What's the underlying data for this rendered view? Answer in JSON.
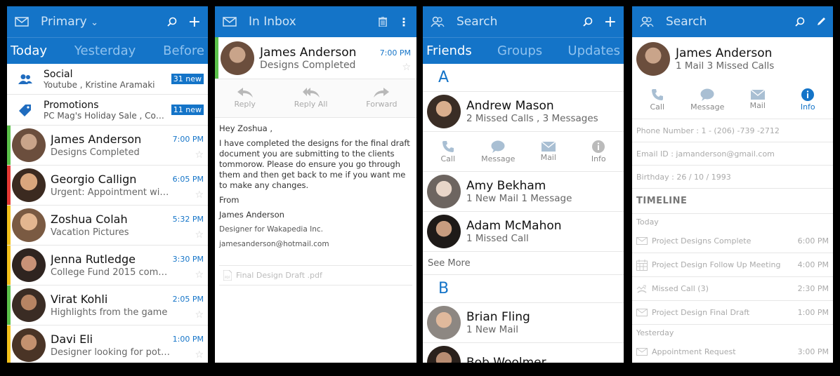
{
  "colors": {
    "accent": "#1474c8",
    "green": "#5cc24b",
    "red": "#e53935",
    "yellow": "#f4c21c"
  },
  "screen1": {
    "title": "Primary",
    "tabs": [
      "Today",
      "Yesterday",
      "Before"
    ],
    "categories": [
      {
        "name": "Social",
        "sub": "Youtube , Kristine Aramaki",
        "badge": "31 new",
        "icon": "people-icon"
      },
      {
        "name": "Promotions",
        "sub": "PC Mag's Holiday Sale , Cour...",
        "badge": "11 new",
        "icon": "tag-icon"
      }
    ],
    "mails": [
      {
        "name": "James Anderson",
        "sub": "Designs Completed",
        "time": "7:00 PM",
        "stripe": "#5cc24b"
      },
      {
        "name": "Georgio Callign",
        "sub": "Urgent: Appointment with ...",
        "time": "6:05 PM",
        "stripe": "#e53935"
      },
      {
        "name": "Zoshua Colah",
        "sub": "Vacation Pictures",
        "time": "5:32 PM",
        "stripe": "#f4c21c"
      },
      {
        "name": "Jenna Rutledge",
        "sub": "College Fund 2015 complete",
        "time": "3:30 PM",
        "stripe": "#f4c21c"
      },
      {
        "name": "Virat Kohli",
        "sub": "Highlights from the game",
        "time": "2:05 PM",
        "stripe": "#5cc24b"
      },
      {
        "name": "Davi Eli",
        "sub": "Designer looking for poten...",
        "time": "1:00 PM",
        "stripe": "#f4c21c"
      }
    ]
  },
  "screen2": {
    "title": "In Inbox",
    "sender": "James Anderson",
    "subject": "Designs Completed",
    "time": "7:00 PM",
    "actions": [
      "Reply",
      "Reply All",
      "Forward"
    ],
    "greeting": "Hey Zoshua ,",
    "body": "I have completed the designs for the final draft document you are submitting to the clients tommorow. Please do ensure you go through them and then get back to me if you want me to make any changes.",
    "from_label": "From",
    "signature_name": "James Anderson",
    "signature_title": "Designer for Wakapedia Inc.",
    "signature_email": "jamesanderson@hotmail.com",
    "attachment": "Final Design Draft .pdf"
  },
  "screen3": {
    "title": "Search",
    "tabs": [
      "Friends",
      "Groups",
      "Updates"
    ],
    "letter_a": "A",
    "letter_b": "B",
    "contact_first": {
      "name": "Andrew Mason",
      "sub": "2 Missed Calls ,  3 Messages"
    },
    "quick_actions": [
      "Call",
      "Message",
      "Mail",
      "Info"
    ],
    "contacts_a": [
      {
        "name": "Amy Bekham",
        "sub": "1 New Mail 1 Message"
      },
      {
        "name": "Adam McMahon",
        "sub": "1 Missed Call"
      }
    ],
    "see_more": "See More",
    "contacts_b": [
      {
        "name": "Brian Fling",
        "sub": "1 New Mail"
      },
      {
        "name": "Bob Woolmer",
        "sub": ""
      }
    ]
  },
  "screen4": {
    "title": "Search",
    "name": "James Anderson",
    "sub": "1 Mail 3 Missed Calls",
    "quick_actions": [
      "Call",
      "Message",
      "Mail",
      "Info"
    ],
    "phone": "Phone Number : 1 - (206) -739 -2712",
    "email": "Email ID : jamanderson@gmail.com",
    "birthday": "Birthday : 26 / 10 / 1993",
    "timeline_title": "TIMELINE",
    "today_label": "Today",
    "today_items": [
      {
        "text": "Project Designs Complete",
        "time": "6:00 PM",
        "icon": "mail-icon"
      },
      {
        "text": "Project Design Follow Up Meeting",
        "time": "4:00 PM",
        "icon": "calendar-icon"
      },
      {
        "text": "Missed Call (3)",
        "time": "2:30 PM",
        "icon": "missed-call-icon"
      },
      {
        "text": "Project Design Final Draft",
        "time": "1:00 PM",
        "icon": "mail-icon"
      }
    ],
    "yesterday_label": "Yesterday",
    "yesterday_items": [
      {
        "text": "Appointment Request",
        "time": "3:00 PM",
        "icon": "mail-icon"
      }
    ]
  }
}
